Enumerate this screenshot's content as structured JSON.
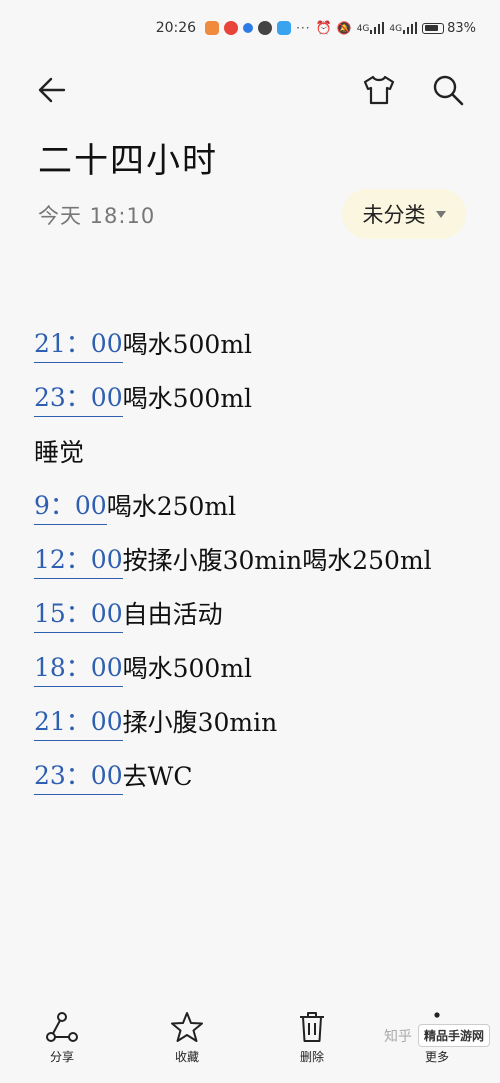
{
  "status_bar": {
    "time": "20:26",
    "more": "···",
    "network_1": "4G",
    "network_2": "4G",
    "battery": "83%",
    "battery_level": 0.83
  },
  "toolbar": {
    "back_icon": "arrow-left-icon",
    "theme_icon": "tshirt-icon",
    "search_icon": "search-icon"
  },
  "note": {
    "title": "二十四小时",
    "date": "今天 18:10",
    "category": "未分类",
    "lines": [
      {
        "time": "21：00",
        "text": "喝水500ml"
      },
      {
        "time": "23：00",
        "text": "喝水500ml"
      },
      {
        "time": "",
        "text": "睡觉"
      },
      {
        "time": "9：00",
        "text": "喝水250ml"
      },
      {
        "time": "12：00",
        "text": "按揉小腹30min喝水250ml"
      },
      {
        "time": "15：00",
        "text": "自由活动"
      },
      {
        "time": "18：00",
        "text": "喝水500ml"
      },
      {
        "time": "21：00",
        "text": "揉小腹30min"
      },
      {
        "time": "23：00",
        "text": "去WC"
      }
    ]
  },
  "bottom_bar": {
    "share": "分享",
    "favorite": "收藏",
    "delete": "删除",
    "more": "更多"
  },
  "watermark": {
    "source": "知乎",
    "badge": "精品手游网"
  },
  "colors": {
    "accent_time": "#2f5fb0",
    "category_bg": "#fbf6df"
  }
}
